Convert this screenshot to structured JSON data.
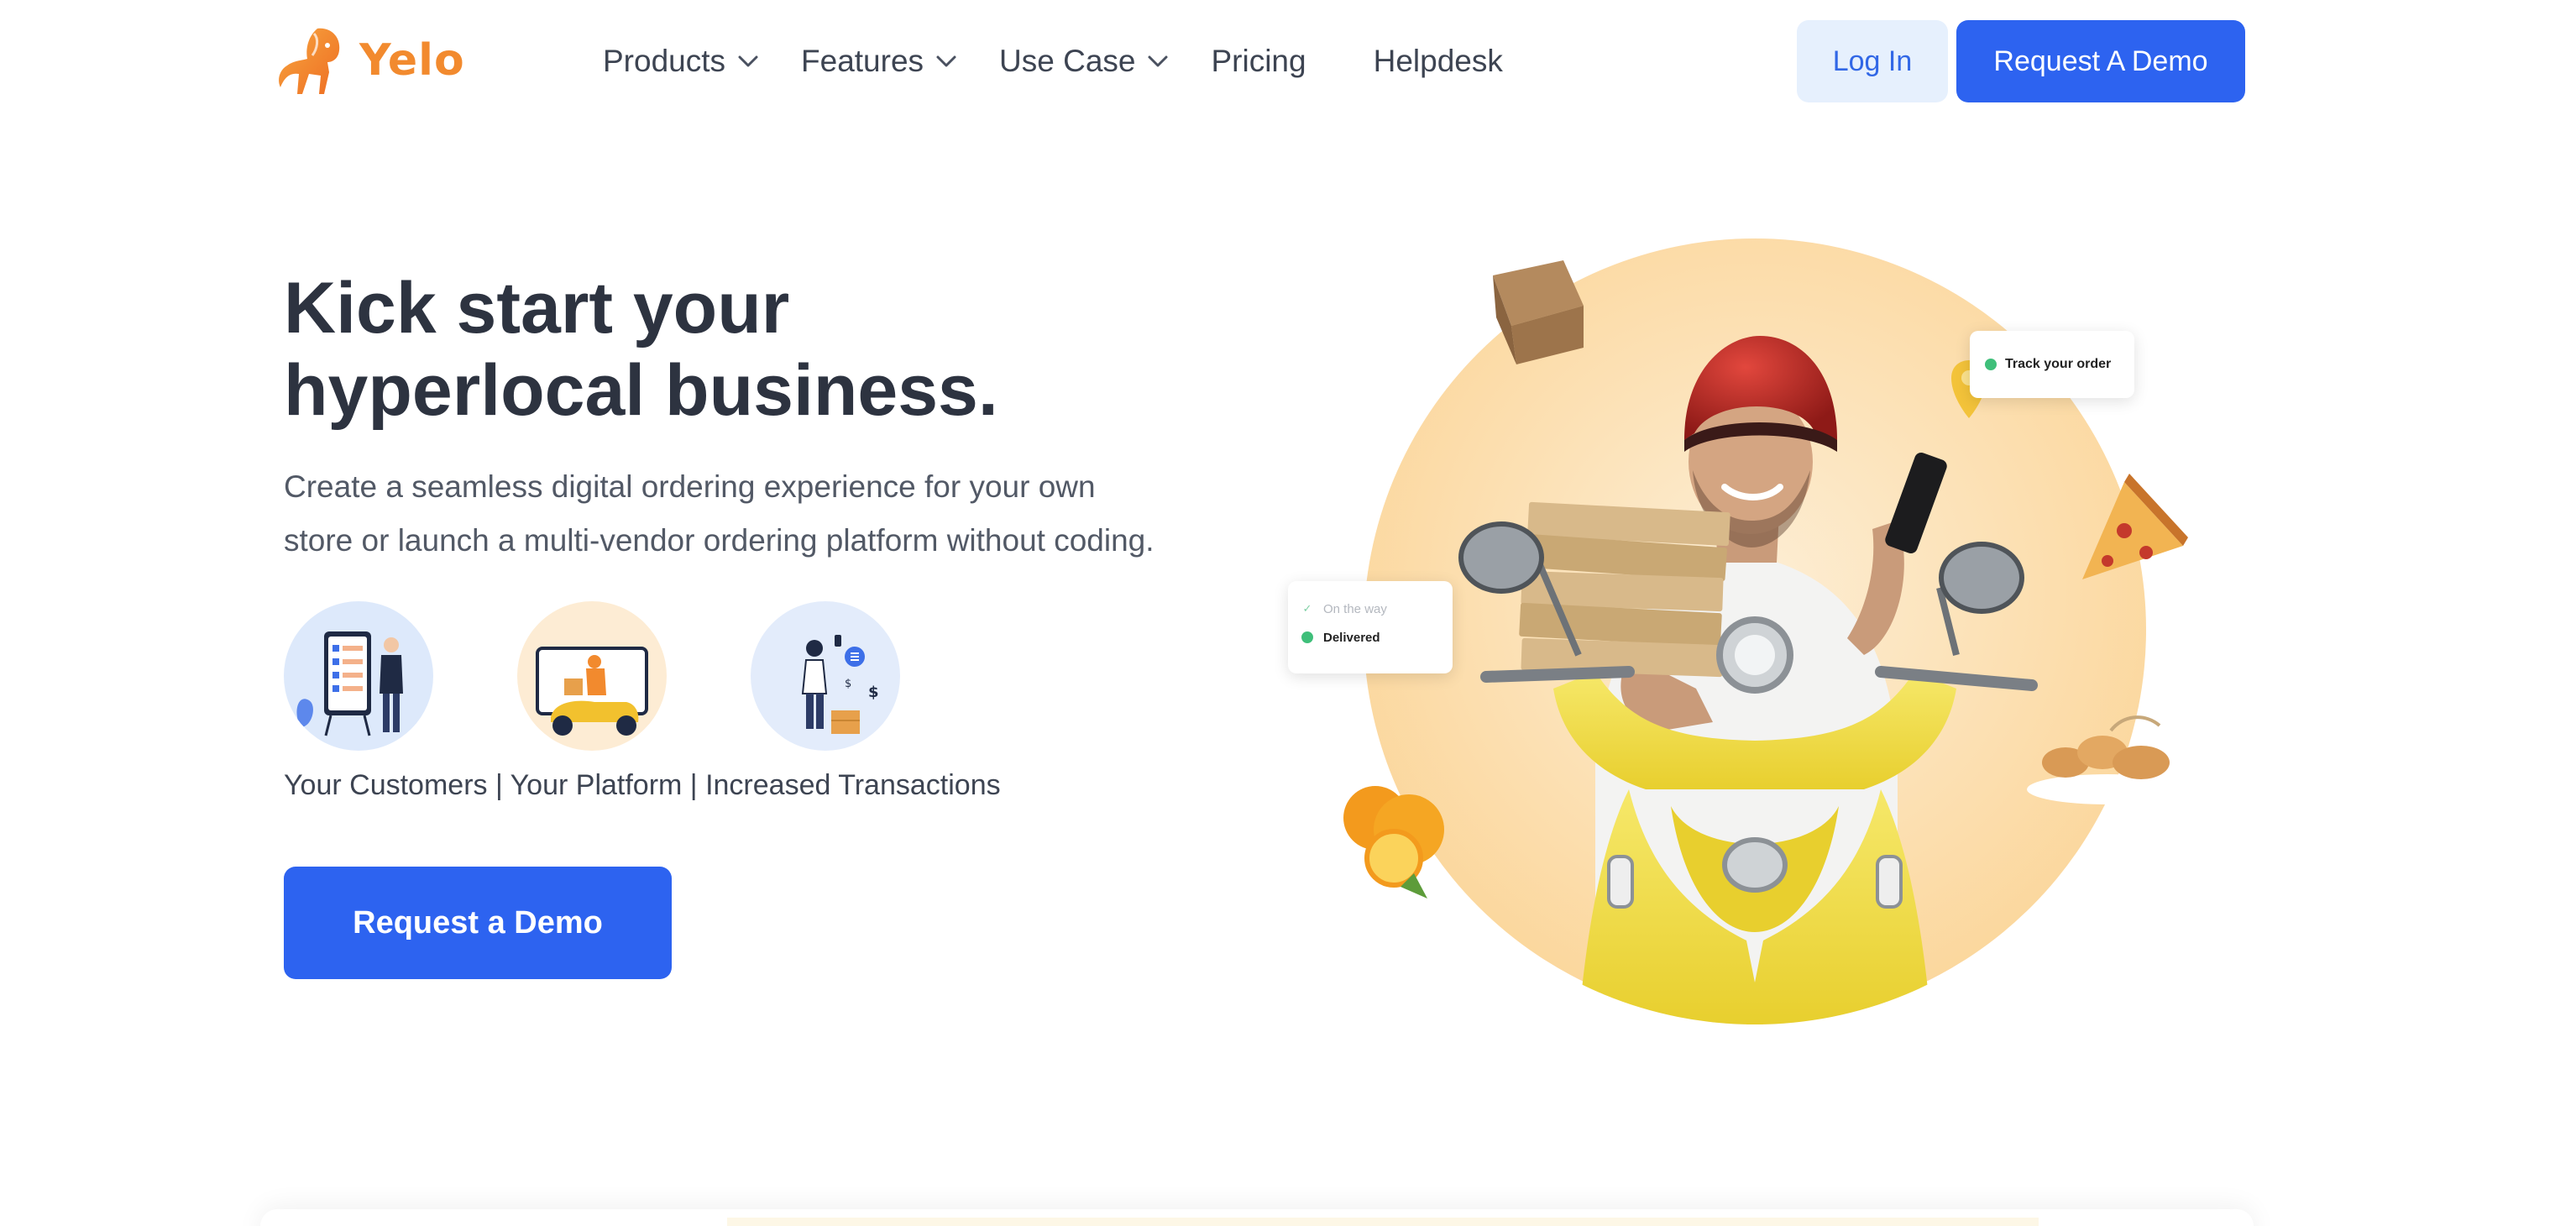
{
  "brand": {
    "name": "Yelo",
    "logo_icon": "lion-icon",
    "color": "#f28a2e"
  },
  "nav": {
    "items": [
      {
        "label": "Products",
        "has_dropdown": true
      },
      {
        "label": "Features",
        "has_dropdown": true
      },
      {
        "label": "Use Case",
        "has_dropdown": true
      },
      {
        "label": "Pricing",
        "has_dropdown": false
      },
      {
        "label": "Helpdesk",
        "has_dropdown": false
      }
    ],
    "login_label": "Log In",
    "demo_label": "Request A Demo"
  },
  "hero": {
    "title_line1": "Kick start your",
    "title_line2": "hyperlocal business.",
    "subtitle_line1": "Create a seamless digital ordering experience for your own",
    "subtitle_line2": "store or launch a multi-vendor ordering platform without coding.",
    "feature_icons": [
      "customer-kiosk-icon",
      "delivery-scooter-icon",
      "transaction-person-icon"
    ],
    "features_caption": "Your Customers | Your Platform | Increased Transactions",
    "cta_label": "Request a Demo"
  },
  "illustration": {
    "track_card_label": "Track your order",
    "status_card": {
      "step1": "On the way",
      "step2": "Delivered"
    }
  },
  "colors": {
    "primary": "#2d63f0",
    "primary_light": "#e6f0fd",
    "hero_circle": "#fcd9a0",
    "scooter": "#f4e04d",
    "success": "#3fbf7a"
  }
}
